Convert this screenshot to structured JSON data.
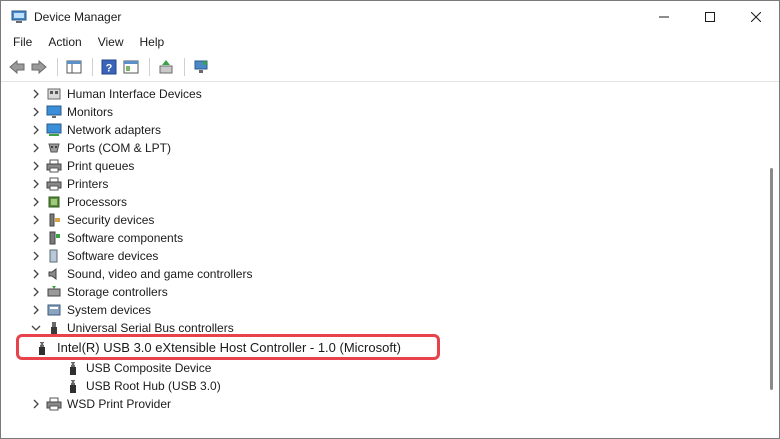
{
  "window": {
    "title": "Device Manager"
  },
  "menu": [
    "File",
    "Action",
    "View",
    "Help"
  ],
  "tree": {
    "items": [
      {
        "label": "Human Interface Devices",
        "icon": "hid-icon",
        "expanded": false
      },
      {
        "label": "Monitors",
        "icon": "monitor-icon",
        "expanded": false
      },
      {
        "label": "Network adapters",
        "icon": "network-adapter-icon",
        "expanded": false
      },
      {
        "label": "Ports (COM & LPT)",
        "icon": "port-icon",
        "expanded": false
      },
      {
        "label": "Print queues",
        "icon": "printer-icon",
        "expanded": false
      },
      {
        "label": "Printers",
        "icon": "printer-icon",
        "expanded": false
      },
      {
        "label": "Processors",
        "icon": "processor-icon",
        "expanded": false
      },
      {
        "label": "Security devices",
        "icon": "security-device-icon",
        "expanded": false
      },
      {
        "label": "Software components",
        "icon": "software-component-icon",
        "expanded": false
      },
      {
        "label": "Software devices",
        "icon": "software-device-icon",
        "expanded": false
      },
      {
        "label": "Sound, video and game controllers",
        "icon": "sound-icon",
        "expanded": false
      },
      {
        "label": "Storage controllers",
        "icon": "storage-icon",
        "expanded": false
      },
      {
        "label": "System devices",
        "icon": "system-device-icon",
        "expanded": false
      },
      {
        "label": "Universal Serial Bus controllers",
        "icon": "usb-icon",
        "expanded": true
      }
    ],
    "usb_children": [
      "Intel(R) USB 3.0 eXtensible Host Controller - 1.0 (Microsoft)",
      "USB Composite Device",
      "USB Root Hub (USB 3.0)"
    ],
    "after": [
      {
        "label": "WSD Print Provider",
        "icon": "printer-icon",
        "expanded": false
      }
    ]
  },
  "colors": {
    "highlight": "#e8424b"
  }
}
